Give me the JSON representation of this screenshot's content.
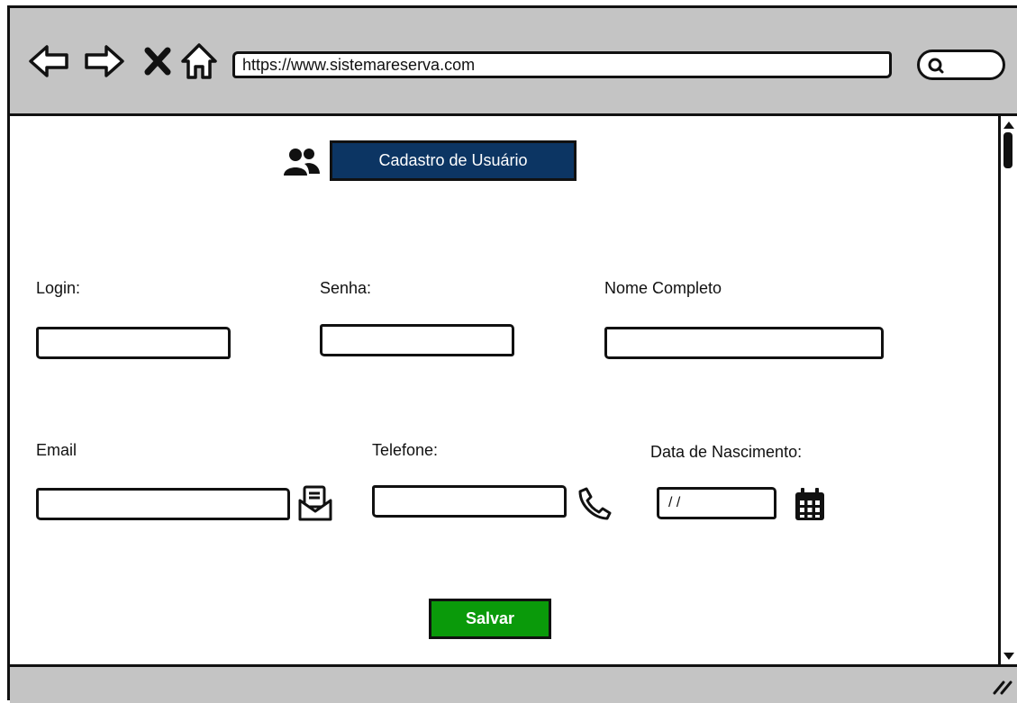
{
  "browser": {
    "url": "https://www.sistemareserva.com"
  },
  "page": {
    "title": "Cadastro de Usuário"
  },
  "form": {
    "login_label": "Login:",
    "senha_label": "Senha:",
    "nome_label": "Nome Completo",
    "email_label": "Email",
    "telefone_label": "Telefone:",
    "nascimento_label": "Data de Nascimento:",
    "nascimento_value": "/ /",
    "save_label": "Salvar"
  },
  "icons": [
    "back-arrow-icon",
    "forward-arrow-icon",
    "close-icon",
    "home-icon",
    "search-icon",
    "users-icon",
    "mail-icon",
    "phone-icon",
    "calendar-icon",
    "resize-grip-icon"
  ],
  "colors": {
    "chrome_bg": "#c4c4c4",
    "title_bg": "#0c3563",
    "save_bg": "#0a9a0a"
  }
}
